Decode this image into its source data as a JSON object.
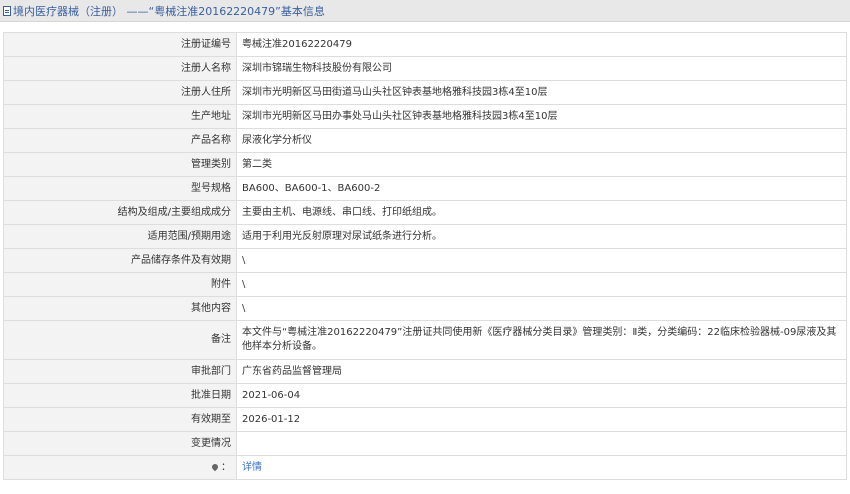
{
  "header": {
    "title": "境内医疗器械（注册） ——“粤械注准20162220479”基本信息"
  },
  "rows": [
    {
      "label": "注册证编号",
      "value": "粤械注准20162220479"
    },
    {
      "label": "注册人名称",
      "value": "深圳市锦瑞生物科技股份有限公司"
    },
    {
      "label": "注册人住所",
      "value": "深圳市光明新区马田街道马山头社区钟表基地格雅科技园3栋4至10层"
    },
    {
      "label": "生产地址",
      "value": "深圳市光明新区马田办事处马山头社区钟表基地格雅科技园3栋4至10层"
    },
    {
      "label": "产品名称",
      "value": "尿液化学分析仪"
    },
    {
      "label": "管理类别",
      "value": "第二类"
    },
    {
      "label": "型号规格",
      "value": "BA600、BA600-1、BA600-2"
    },
    {
      "label": "结构及组成/主要组成成分",
      "value": "主要由主机、电源线、串口线、打印纸组成。"
    },
    {
      "label": "适用范围/预期用途",
      "value": "适用于利用光反射原理对尿试纸条进行分析。"
    },
    {
      "label": "产品储存条件及有效期",
      "value": "\\"
    },
    {
      "label": "附件",
      "value": "\\"
    },
    {
      "label": "其他内容",
      "value": "\\"
    },
    {
      "label": "备注",
      "value": "本文件与“粤械注准20162220479”注册证共同使用新《医疗器械分类目录》管理类别：Ⅱ类，分类编码：22临床检验器械-09尿液及其他样本分析设备。"
    },
    {
      "label": "审批部门",
      "value": "广东省药品监督管理局"
    },
    {
      "label": "批准日期",
      "value": "2021-06-04"
    },
    {
      "label": "有效期至",
      "value": "2026-01-12"
    },
    {
      "label": "变更情况",
      "value": ""
    }
  ],
  "detail_row": {
    "icon": "location-pin-icon",
    "link_label": "详情"
  },
  "colors": {
    "header_bg": "#e8e8e8",
    "header_text": "#3a5f9e",
    "label_bg": "#f3f3f3",
    "border": "#dddddd",
    "link": "#3a6fc4"
  }
}
